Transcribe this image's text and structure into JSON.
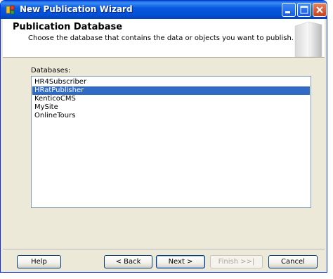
{
  "window": {
    "title": "New Publication Wizard"
  },
  "titlebar_buttons": [
    "minimize-icon",
    "maximize-icon",
    "close-icon"
  ],
  "header": {
    "title": "Publication Database",
    "subtitle": "Choose the database that contains the data or objects you want to publish."
  },
  "databases": {
    "label": "Databases:",
    "items": [
      "HR4Subscriber",
      "HRatPublisher",
      "KenticoCMS",
      "MySite",
      "OnlineTours"
    ],
    "selected": "HRatPublisher"
  },
  "buttons": {
    "help": "Help",
    "back": "< Back",
    "next": "Next >",
    "finish": "Finish >>|",
    "cancel": "Cancel"
  },
  "colors": {
    "selection": "#316ac5",
    "titlebar": "#0758e0",
    "dialog": "#ece9d8"
  }
}
